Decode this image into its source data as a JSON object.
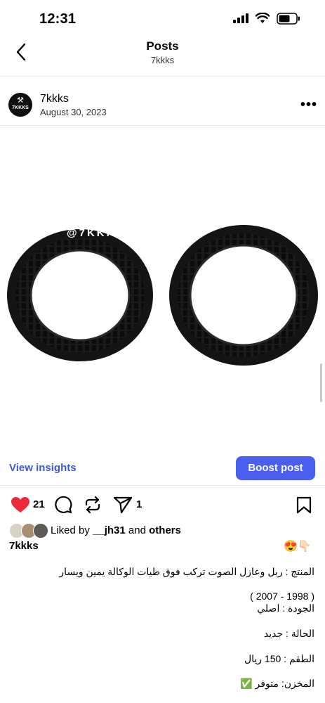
{
  "status_bar": {
    "time": "12:31"
  },
  "header": {
    "title": "Posts",
    "subtitle": "7kkks"
  },
  "post": {
    "account": "7kkks",
    "date": "August 30, 2023",
    "avatar_text": "7KKKS",
    "watermark": "@7KKKS",
    "insights_label": "View insights",
    "boost_label": "Boost post",
    "like_count": "21",
    "share_count": "1",
    "liked_by_prefix": "Liked by",
    "liked_by_user": "__jh31",
    "liked_by_and": "and",
    "liked_by_others": "others",
    "caption_user": "7kkks",
    "caption_emojis": "😍👇🏻",
    "caption_lines": {
      "product": "المنتج : ربل وعازل الصوت تركب فوق طيات الوكالة  يمين ويسار",
      "years": "( 2007 - 1998 )",
      "quality": "الجودة : اصلي",
      "condition": "الحالة : جديد",
      "price": "الطقم : 150 ريال",
      "stock": "المخزن: متوفر ✅"
    }
  },
  "colors": {
    "accent": "#4a5ef0",
    "link": "#3b5bd6",
    "like": "#ed2a3c"
  },
  "icons": [
    "back-icon",
    "more-icon",
    "heart-icon",
    "comment-icon",
    "repost-icon",
    "share-icon",
    "bookmark-icon"
  ]
}
